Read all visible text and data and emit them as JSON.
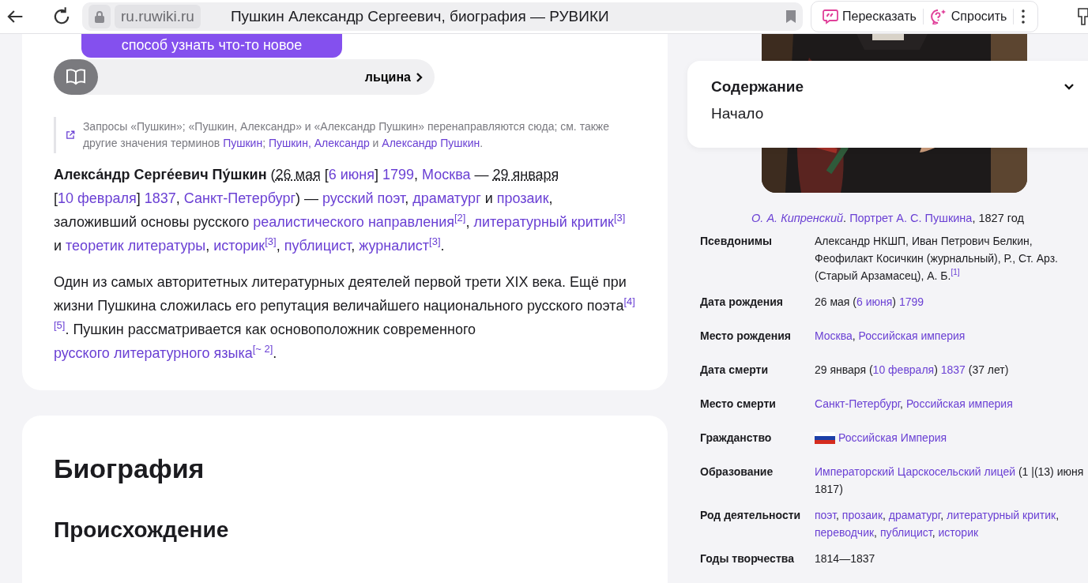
{
  "browser": {
    "domain": "ru.ruwiki.ru",
    "title": "Пушкин Александр Сергеевич, биография — РУВИКИ",
    "actions": [
      {
        "label": "Пересказать",
        "kind": "retell"
      },
      {
        "label": "Спросить",
        "kind": "ask"
      }
    ]
  },
  "banner": {
    "text": "способ узнать что-то новое"
  },
  "pill": {
    "label": "льцина"
  },
  "hatnote": [
    {
      "text": "Запросы «Пушкин»; «Пушкин, Александр» и «Александр Пушкин» перенаправляются сюда; см. также другие значения терминов ",
      "kind": "plain"
    },
    {
      "text": "Пушкин",
      "kind": "link"
    },
    {
      "text": "; ",
      "kind": "plain"
    },
    {
      "text": "Пушкин, Александр",
      "kind": "link"
    },
    {
      "text": " и ",
      "kind": "plain"
    },
    {
      "text": "Александр Пушкин",
      "kind": "link"
    },
    {
      "text": ".",
      "kind": "plain"
    }
  ],
  "paragraphs": [
    [
      {
        "text": "**Алекса́ндр Серге́евич Пу́шкин** (",
        "kind": "plain"
      },
      {
        "text": "26 мая",
        "kind": "dotted"
      },
      {
        "text": " [",
        "kind": "plain"
      },
      {
        "text": "6 июня",
        "kind": "link"
      },
      {
        "text": "] ",
        "kind": "plain"
      },
      {
        "text": "1799",
        "kind": "link"
      },
      {
        "text": ", ",
        "kind": "plain"
      },
      {
        "text": "Москва",
        "kind": "link"
      },
      {
        "text": " — ",
        "kind": "plain"
      },
      {
        "text": "29 января",
        "kind": "dotted"
      },
      {
        "text": " [",
        "kind": "plain"
      },
      {
        "text": "10 февраля",
        "kind": "link"
      },
      {
        "text": "] ",
        "kind": "plain"
      },
      {
        "text": "1837",
        "kind": "link"
      },
      {
        "text": ", ",
        "kind": "plain"
      },
      {
        "text": "Санкт-Петербург",
        "kind": "link"
      },
      {
        "text": ") — ",
        "kind": "plain"
      },
      {
        "text": "русский поэт",
        "kind": "link"
      },
      {
        "text": ", ",
        "kind": "plain"
      },
      {
        "text": "драматург",
        "kind": "link"
      },
      {
        "text": " и ",
        "kind": "plain"
      },
      {
        "text": "прозаик",
        "kind": "link"
      },
      {
        "text": ", заложивший основы русского ",
        "kind": "plain"
      },
      {
        "text": "реалистического направления",
        "kind": "link"
      },
      {
        "text": "[2]",
        "kind": "ref"
      },
      {
        "text": ", ",
        "kind": "plain"
      },
      {
        "text": "литературный критик",
        "kind": "link"
      },
      {
        "text": "[3]",
        "kind": "ref"
      },
      {
        "text": " и ",
        "kind": "plain"
      },
      {
        "text": "теоретик литературы",
        "kind": "link"
      },
      {
        "text": ", ",
        "kind": "plain"
      },
      {
        "text": "историк",
        "kind": "link"
      },
      {
        "text": "[3]",
        "kind": "ref"
      },
      {
        "text": ", ",
        "kind": "plain"
      },
      {
        "text": "публицист",
        "kind": "link"
      },
      {
        "text": ", ",
        "kind": "plain"
      },
      {
        "text": "журналист",
        "kind": "link"
      },
      {
        "text": "[3]",
        "kind": "ref"
      },
      {
        "text": ".",
        "kind": "plain"
      }
    ],
    [
      {
        "text": "Один из самых авторитетных литературных деятелей первой трети XIX века. Ещё при жизни Пушкина сложилась его репутация величайшего национального русского поэта",
        "kind": "plain"
      },
      {
        "text": "[4]",
        "kind": "ref"
      },
      {
        "text": "[5]",
        "kind": "ref"
      },
      {
        "text": ". Пушкин рассматривается как основоположник современного ",
        "kind": "plain"
      },
      {
        "text": "русского литературного языка",
        "kind": "link"
      },
      {
        "text": "[~ 2]",
        "kind": "ref"
      },
      {
        "text": ".",
        "kind": "plain"
      }
    ]
  ],
  "headings": [
    {
      "text": "Биография",
      "kind": "section"
    },
    {
      "text": "Происхождение",
      "kind": "subsection"
    }
  ],
  "contents": {
    "title": "Содержание",
    "items": [
      "Начало"
    ]
  },
  "caption": [
    {
      "text": "О. А. Кипренский",
      "kind": "italic_link"
    },
    {
      "text": ". ",
      "kind": "plain"
    },
    {
      "text": "Портрет А. С. Пушкина",
      "kind": "link"
    },
    {
      "text": ", 1827 год",
      "kind": "plain"
    }
  ],
  "infobox": [
    {
      "label": "Псевдонимы",
      "value": [
        {
          "text": "Александр НКШП, Иван Петрович Белкин, Феофилакт Косичкин (журнальный), Р., Ст. Арз. (Старый Арзамасец), А. Б.",
          "kind": "plain"
        },
        {
          "text": "[1]",
          "kind": "ref"
        }
      ]
    },
    {
      "label": "Дата рождения",
      "value": [
        {
          "text": "26 мая (",
          "kind": "plain"
        },
        {
          "text": "6 июня",
          "kind": "link"
        },
        {
          "text": ") ",
          "kind": "plain"
        },
        {
          "text": "1799",
          "kind": "link"
        }
      ]
    },
    {
      "label": "Место рождения",
      "value": [
        {
          "text": "Москва",
          "kind": "link"
        },
        {
          "text": ", ",
          "kind": "plain"
        },
        {
          "text": "Российская империя",
          "kind": "link"
        }
      ]
    },
    {
      "label": "Дата смерти",
      "value": [
        {
          "text": "29 января (",
          "kind": "plain"
        },
        {
          "text": "10 февраля",
          "kind": "link"
        },
        {
          "text": ") ",
          "kind": "plain"
        },
        {
          "text": "1837",
          "kind": "link"
        },
        {
          "text": " (37 лет)",
          "kind": "plain"
        }
      ]
    },
    {
      "label": "Место смерти",
      "value": [
        {
          "text": "Санкт-Петербург",
          "kind": "link"
        },
        {
          "text": ", ",
          "kind": "plain"
        },
        {
          "text": "Российская империя",
          "kind": "link"
        }
      ]
    },
    {
      "label": "Гражданство",
      "value": [
        {
          "kind": "flag"
        },
        {
          "text": "Российская Империя",
          "kind": "link"
        }
      ]
    },
    {
      "label": "Образование",
      "value": [
        {
          "text": "Императорский Царскосельский лицей",
          "kind": "link"
        },
        {
          "text": " (1 |(13) июня 1817)",
          "kind": "plain"
        }
      ]
    },
    {
      "label": "Род деятельности",
      "value": [
        {
          "text": "поэт",
          "kind": "link"
        },
        {
          "text": ", ",
          "kind": "plain"
        },
        {
          "text": "прозаик",
          "kind": "link"
        },
        {
          "text": ", ",
          "kind": "plain"
        },
        {
          "text": "драматург",
          "kind": "link"
        },
        {
          "text": ", ",
          "kind": "plain"
        },
        {
          "text": "литературный критик",
          "kind": "link"
        },
        {
          "text": ", ",
          "kind": "plain"
        },
        {
          "text": "переводчик",
          "kind": "link"
        },
        {
          "text": ", ",
          "kind": "plain"
        },
        {
          "text": "публицист",
          "kind": "link"
        },
        {
          "text": ", ",
          "kind": "plain"
        },
        {
          "text": "историк",
          "kind": "link"
        }
      ]
    },
    {
      "label": "Годы творчества",
      "value": [
        {
          "text": "1814—1837",
          "kind": "plain"
        }
      ]
    }
  ]
}
